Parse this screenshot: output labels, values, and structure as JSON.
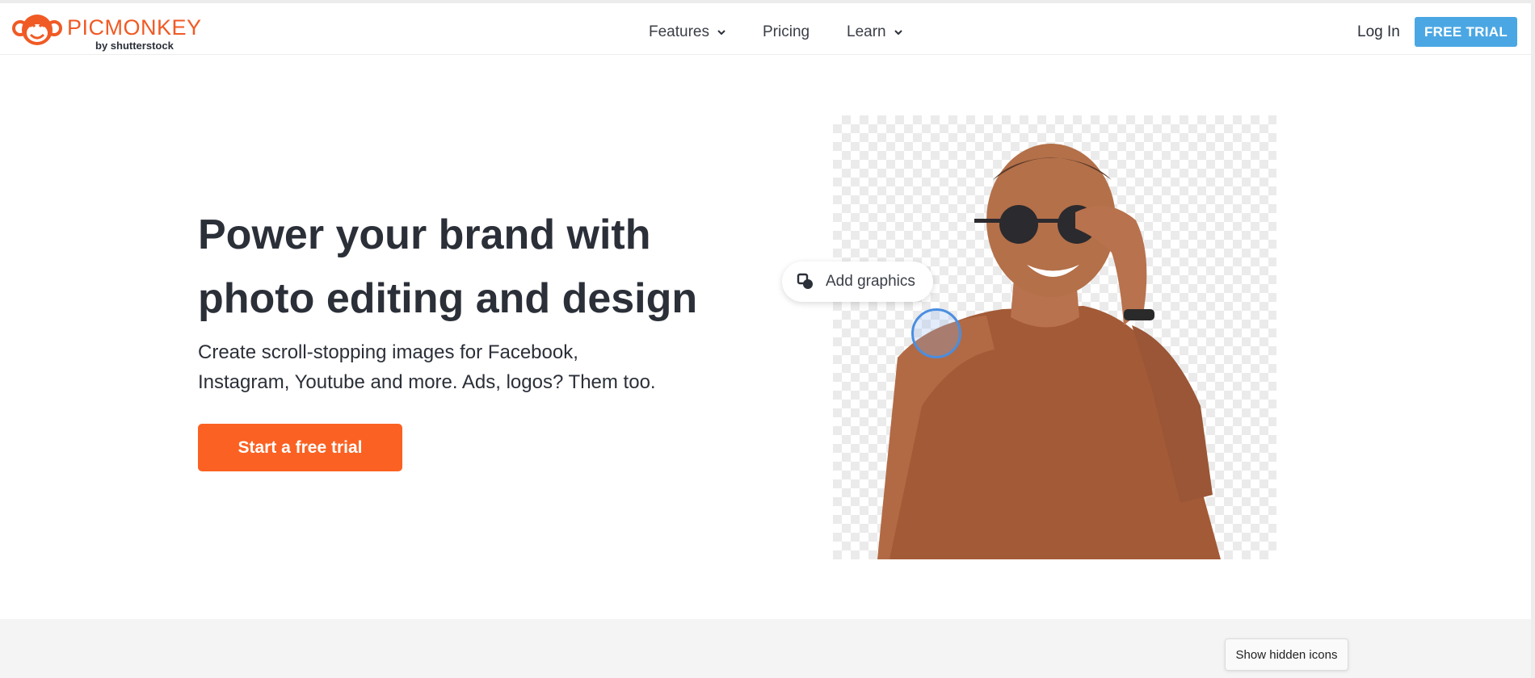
{
  "header": {
    "logo_text": "PICMONKEY",
    "logo_sub": "by shutterstock",
    "nav": [
      {
        "label": "Features",
        "dropdown": true
      },
      {
        "label": "Pricing",
        "dropdown": false
      },
      {
        "label": "Learn",
        "dropdown": true
      }
    ],
    "login_label": "Log In",
    "trial_label": "FREE TRIAL"
  },
  "hero": {
    "title_line1": "Power your brand with",
    "title_line2": "photo editing and design",
    "subtitle_line1": "Create scroll-stopping images for Facebook,",
    "subtitle_line2": "Instagram, Youtube and more. Ads, logos? Them too.",
    "cta_label": "Start a free trial"
  },
  "demo": {
    "pill_label": "Add graphics",
    "pill_icon": "shapes-icon"
  },
  "tooltip": {
    "label": "Show hidden icons"
  },
  "colors": {
    "brand_orange": "#fb6122",
    "trial_blue": "#4aa7e3",
    "text_dark": "#2b2f38"
  }
}
